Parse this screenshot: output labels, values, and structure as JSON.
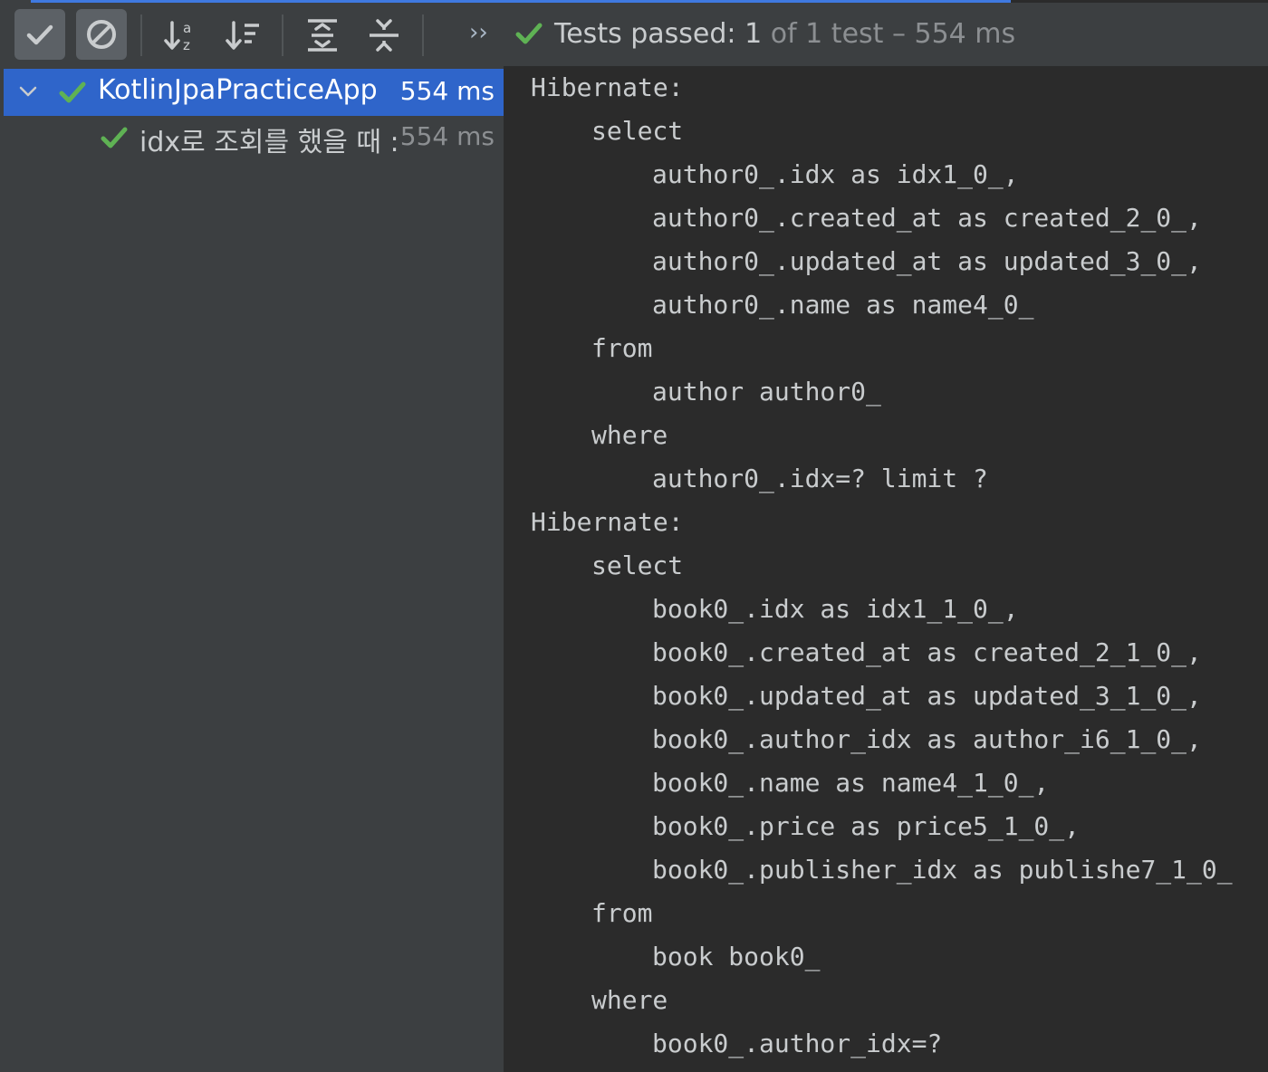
{
  "toolbar": {
    "buttons": [
      {
        "name": "show-passed-button",
        "icon": "check-icon",
        "toggled": true
      },
      {
        "name": "show-ignored-button",
        "icon": "cancel-circle-icon",
        "toggled": true
      },
      {
        "name": "sort-alphabetically-button",
        "icon": "sort-alpha-icon",
        "toggled": false
      },
      {
        "name": "sort-by-duration-button",
        "icon": "sort-duration-icon",
        "toggled": false
      },
      {
        "name": "expand-all-button",
        "icon": "expand-all-icon",
        "toggled": false
      },
      {
        "name": "collapse-all-button",
        "icon": "collapse-all-icon",
        "toggled": false
      }
    ],
    "overflow_label": "››"
  },
  "summary": {
    "prefix": "Tests passed:",
    "count": "1",
    "rest": "of 1 test – 554 ms",
    "status_icon": "check-icon"
  },
  "colors": {
    "accent_blue": "#3f79e0",
    "selection": "#2f65ca",
    "pass_green": "#5fb254",
    "panel_bg": "#3c3f41",
    "console_bg": "#2b2b2b",
    "console_text": "#c9ccce",
    "muted_text": "#8c8f92"
  },
  "tree": {
    "root": {
      "label": "KotlinJpaPracticeApp",
      "time": "554 ms",
      "expanded": true,
      "status": "passed"
    },
    "children": [
      {
        "label": "idx로 조회를 했을 때 :",
        "time": "554 ms",
        "status": "passed"
      }
    ]
  },
  "console": {
    "lines": [
      {
        "indent": 0,
        "text": "Hibernate:"
      },
      {
        "indent": 1,
        "text": "select"
      },
      {
        "indent": 2,
        "text": "author0_.idx as idx1_0_,"
      },
      {
        "indent": 2,
        "text": "author0_.created_at as created_2_0_,"
      },
      {
        "indent": 2,
        "text": "author0_.updated_at as updated_3_0_,"
      },
      {
        "indent": 2,
        "text": "author0_.name as name4_0_"
      },
      {
        "indent": 1,
        "text": "from"
      },
      {
        "indent": 2,
        "text": "author author0_"
      },
      {
        "indent": 1,
        "text": "where"
      },
      {
        "indent": 2,
        "text": "author0_.idx=? limit ?"
      },
      {
        "indent": 0,
        "text": "Hibernate:"
      },
      {
        "indent": 1,
        "text": "select"
      },
      {
        "indent": 2,
        "text": "book0_.idx as idx1_1_0_,"
      },
      {
        "indent": 2,
        "text": "book0_.created_at as created_2_1_0_,"
      },
      {
        "indent": 2,
        "text": "book0_.updated_at as updated_3_1_0_,"
      },
      {
        "indent": 2,
        "text": "book0_.author_idx as author_i6_1_0_,"
      },
      {
        "indent": 2,
        "text": "book0_.name as name4_1_0_,"
      },
      {
        "indent": 2,
        "text": "book0_.price as price5_1_0_,"
      },
      {
        "indent": 2,
        "text": "book0_.publisher_idx as publishe7_1_0_"
      },
      {
        "indent": 1,
        "text": "from"
      },
      {
        "indent": 2,
        "text": "book book0_"
      },
      {
        "indent": 1,
        "text": "where"
      },
      {
        "indent": 2,
        "text": "book0_.author_idx=?"
      }
    ]
  }
}
